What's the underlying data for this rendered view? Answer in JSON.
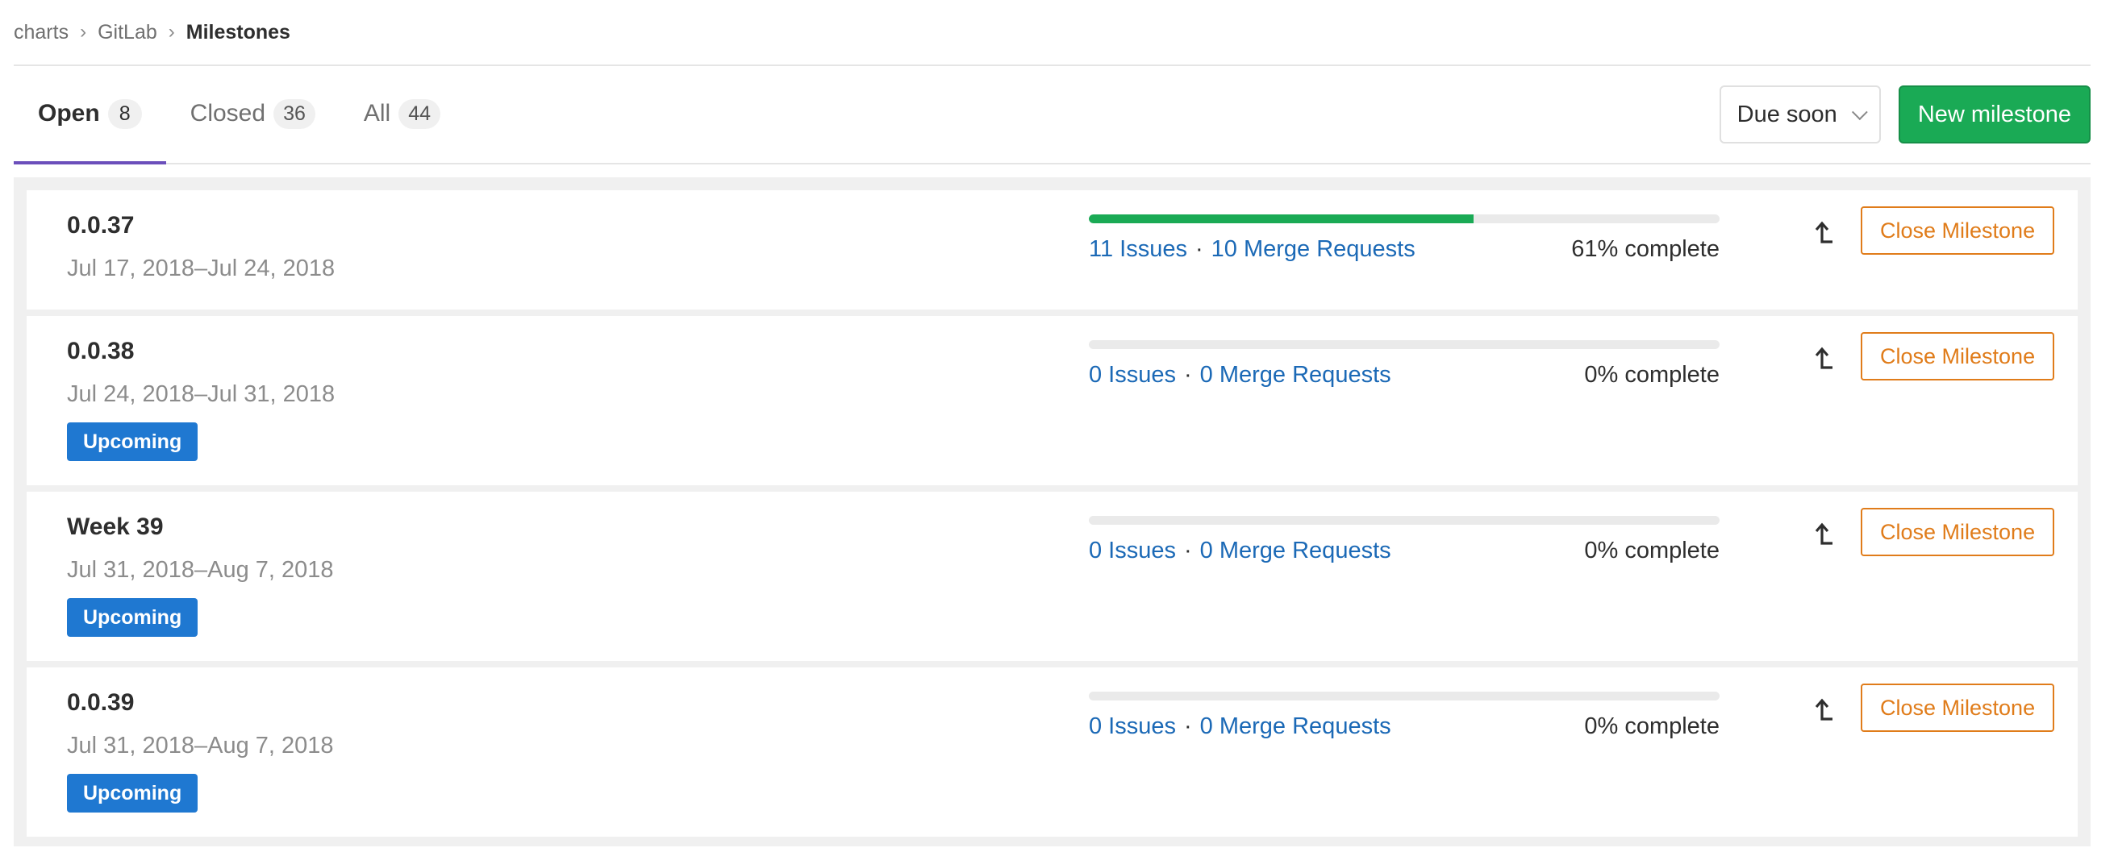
{
  "breadcrumb": {
    "items": [
      "charts",
      "GitLab"
    ],
    "current": "Milestones"
  },
  "tabs": [
    {
      "label": "Open",
      "count": "8",
      "active": true
    },
    {
      "label": "Closed",
      "count": "36",
      "active": false
    },
    {
      "label": "All",
      "count": "44",
      "active": false
    }
  ],
  "actions": {
    "sort_label": "Due soon",
    "new_label": "New milestone"
  },
  "colors": {
    "accent_tab": "#6b4fbb",
    "new_button": "#1aaa55",
    "progress": "#1aaa55",
    "link": "#1b69b6",
    "badge": "#1f78d1",
    "close_button": "#e07c1a"
  },
  "icons": {
    "promote": "level-up-icon",
    "sort": "chevron-down-icon"
  },
  "milestones": [
    {
      "title": "0.0.37",
      "dates": "Jul 17, 2018–Jul 24, 2018",
      "badge": "",
      "progress": 0.61,
      "issues": "11 Issues",
      "merge_requests": "10 Merge Requests",
      "complete": "61% complete",
      "close_label": "Close Milestone"
    },
    {
      "title": "0.0.38",
      "dates": "Jul 24, 2018–Jul 31, 2018",
      "badge": "Upcoming",
      "progress": 0,
      "issues": "0 Issues",
      "merge_requests": "0 Merge Requests",
      "complete": "0% complete",
      "close_label": "Close Milestone"
    },
    {
      "title": "Week 39",
      "dates": "Jul 31, 2018–Aug 7, 2018",
      "badge": "Upcoming",
      "progress": 0,
      "issues": "0 Issues",
      "merge_requests": "0 Merge Requests",
      "complete": "0% complete",
      "close_label": "Close Milestone"
    },
    {
      "title": "0.0.39",
      "dates": "Jul 31, 2018–Aug 7, 2018",
      "badge": "Upcoming",
      "progress": 0,
      "issues": "0 Issues",
      "merge_requests": "0 Merge Requests",
      "complete": "0% complete",
      "close_label": "Close Milestone"
    }
  ]
}
